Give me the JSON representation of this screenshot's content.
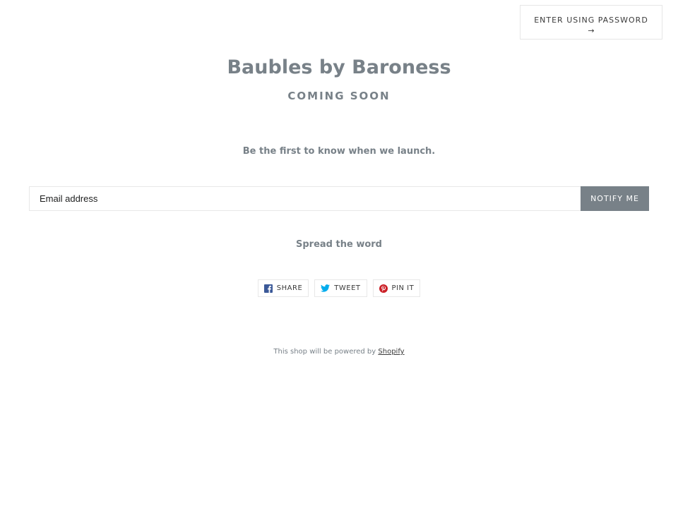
{
  "header": {
    "password_button_label": "ENTER USING PASSWORD",
    "password_button_arrow": "→"
  },
  "store": {
    "name": "Baubles by Baroness",
    "status": "COMING SOON"
  },
  "signup": {
    "tagline": "Be the first to know when we launch.",
    "email_placeholder": "Email address",
    "email_value": "",
    "submit_label": "NOTIFY ME"
  },
  "share": {
    "heading": "Spread the word",
    "buttons": [
      {
        "label": "SHARE",
        "icon": "facebook-icon",
        "color": "#3b5998"
      },
      {
        "label": "TWEET",
        "icon": "twitter-icon",
        "color": "#00aced"
      },
      {
        "label": "PIN IT",
        "icon": "pinterest-icon",
        "color": "#cb2027"
      }
    ]
  },
  "footer": {
    "text": "This shop will be powered by",
    "link_label": "Shopify"
  },
  "colors": {
    "accent": "#788188",
    "text_dark": "#3a3a3a",
    "border": "#e8e8e8"
  }
}
